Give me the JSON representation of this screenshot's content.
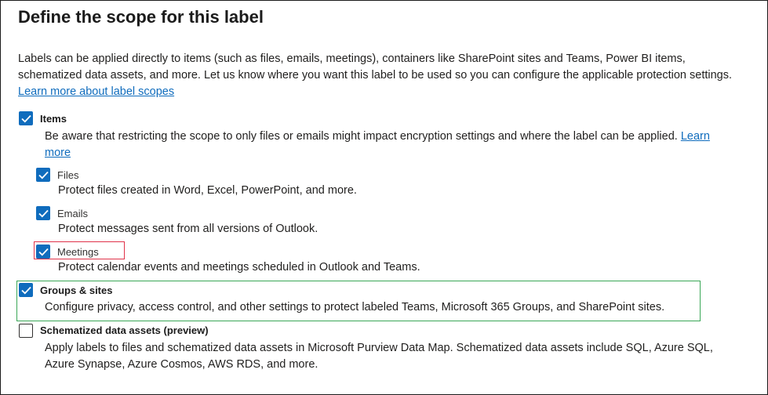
{
  "title": "Define the scope for this label",
  "intro": {
    "text": "Labels can be applied directly to items (such as files, emails, meetings), containers like SharePoint sites and Teams, Power BI items, schematized data assets, and more. Let us know where you want this label to be used so you can configure the applicable protection settings.",
    "link": "Learn more about label scopes"
  },
  "items": {
    "label": "Items",
    "checked": true,
    "description": "Be aware that restricting the scope to only files or emails might impact encryption settings and where the label can be applied.",
    "link_part1": "Learn",
    "link_part2": "more",
    "children": [
      {
        "label": "Files",
        "checked": true,
        "description": "Protect files created in Word, Excel, PowerPoint, and more."
      },
      {
        "label": "Emails",
        "checked": true,
        "description": "Protect messages sent from all versions of Outlook."
      },
      {
        "label": "Meetings",
        "checked": true,
        "description": "Protect calendar events and meetings scheduled in Outlook and Teams."
      }
    ]
  },
  "groups": {
    "label": "Groups & sites",
    "checked": true,
    "description": "Configure privacy, access control, and other settings to protect labeled Teams, Microsoft 365 Groups, and SharePoint sites."
  },
  "schematized": {
    "label": "Schematized data assets (preview)",
    "checked": false,
    "description_line1": "Apply labels to files and schematized data assets in Microsoft Purview Data Map. Schematized data assets include SQL, Azure SQL,",
    "description_line2": "Azure Synapse, Azure Cosmos, AWS RDS, and more."
  },
  "colors": {
    "accent": "#0f6cbd",
    "highlight_red": "#e0334a",
    "highlight_green": "#3aa757"
  }
}
